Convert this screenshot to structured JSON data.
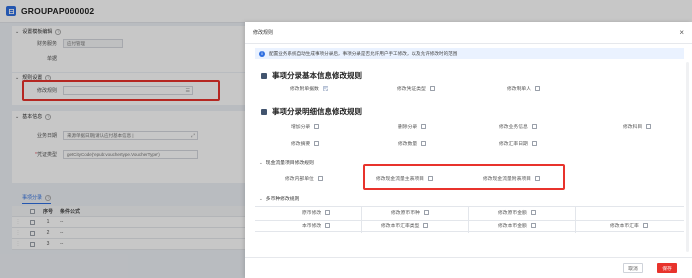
{
  "header": {
    "title": "GROUPAP000002"
  },
  "form": {
    "section_settings": "设置模板编辑",
    "label_row1": "财务服务",
    "value_row1": "应付管理",
    "label_row2": "单据",
    "value_row2": "",
    "section_rules": "规则设置",
    "label_rule": "修改规则",
    "section_basic": "基本信息",
    "label_date": "业务日期",
    "value_date": "来源单据日期|请认应付基本信息 |",
    "label_voucher": "凭证类型",
    "value_voucher": "getCityCode('epub:vouchertype.VoucherType')"
  },
  "tabs": {
    "active": "事项分录"
  },
  "table": {
    "headers": [
      "",
      "序号",
      "条件公式"
    ],
    "rows": [
      {
        "idx": "1",
        "formula": "--"
      },
      {
        "idx": "2",
        "formula": "--"
      },
      {
        "idx": "3",
        "formula": "--"
      }
    ]
  },
  "modal": {
    "title": "修改规则",
    "notice": "配置业务系统自动生成事项分录后，事项分录是否允许用户手工修改，以及允许修改时的范围",
    "sec1_title": "事项分录基本信息修改规则",
    "sec1_opts": [
      {
        "label": "修改附单据数",
        "checked": true
      },
      {
        "label": "修改凭证类型",
        "checked": false
      },
      {
        "label": "修改制单人",
        "checked": false
      }
    ],
    "sec2_title": "事项分录明细信息修改规则",
    "sec2_opts": [
      {
        "label": "增加分录",
        "checked": false
      },
      {
        "label": "删除分录",
        "checked": false
      },
      {
        "label": "修改业务信息",
        "checked": false
      },
      {
        "label": "修改科目",
        "checked": false
      },
      {
        "label": "修改摘要",
        "checked": false
      },
      {
        "label": "修改数量",
        "checked": false
      },
      {
        "label": "修改汇率日期",
        "checked": false
      }
    ],
    "sec3_title": "现金流量项目修改规则",
    "sec3_opts": [
      {
        "label": "修改内部单位",
        "checked": false
      },
      {
        "label": "修改现金流量主表项目",
        "checked": false
      },
      {
        "label": "修改现金流量附表项目",
        "checked": false
      }
    ],
    "sec4_title": "多币种修改规则",
    "sec4_opts": [
      {
        "label": "原币修改",
        "checked": false
      },
      {
        "label": "修改原币币种",
        "checked": false
      },
      {
        "label": "修改原币金额",
        "checked": false
      },
      {
        "label": "本币修改",
        "checked": false
      },
      {
        "label": "修改本币汇率类型",
        "checked": false
      },
      {
        "label": "修改本币金额",
        "checked": false
      },
      {
        "label": "修改本币汇率",
        "checked": false
      }
    ],
    "cancel": "取消",
    "save": "保存"
  },
  "colors": {
    "accent": "#2f6fe0",
    "highlight": "#e8332c",
    "save": "#e8332c"
  }
}
